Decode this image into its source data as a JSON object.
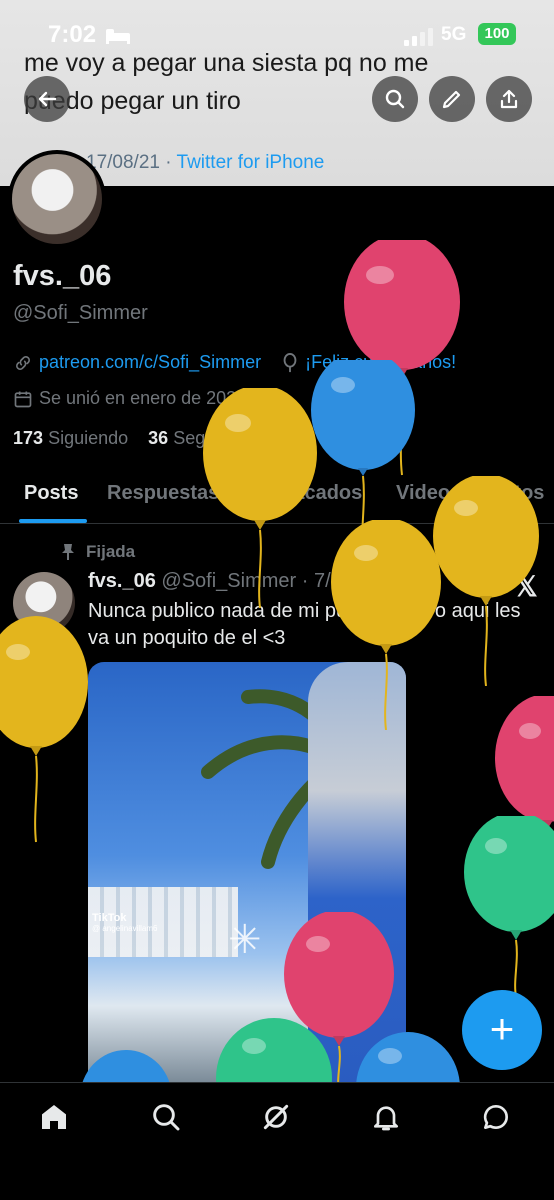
{
  "status_bar": {
    "time": "7:02",
    "network": "5G",
    "battery": "100"
  },
  "background_tweet": {
    "text": "me voy a pegar una siesta pq no me puedo pegar un tiro",
    "date": "17/08/21",
    "separator": "·",
    "source": "Twitter for iPhone"
  },
  "profile": {
    "name": "fvs._06",
    "handle": "@Sofi_Simmer",
    "link": "patreon.com/c/Sofi_Simmer",
    "birthday": "¡Feliz cumpleaños!",
    "joined": "Se unió en enero de 2023",
    "following_count": "173",
    "following_label": "Siguiendo",
    "followers_count": "36",
    "followers_label": "Seguidores"
  },
  "tabs": [
    "Posts",
    "Respuestas",
    "Destacados",
    "Videos",
    "Fotos"
  ],
  "pinned_tweet": {
    "pinned_label": "Fijada",
    "name": "fvs._06",
    "handle": "@Sofi_Simmer",
    "separator": "·",
    "date": "7/5/26",
    "text": "Nunca publico nada de mi pueblito, pero aqui les va un poquito de el <3",
    "media_watermark": "TikTok",
    "media_user": "@ angelinavillam6"
  },
  "fab_label": "+",
  "colors": {
    "accent": "#1d9bf0",
    "balloon_red": "#e0436e",
    "balloon_yellow": "#e3b51d",
    "balloon_blue": "#2f8fe0",
    "balloon_green": "#2fc48a"
  },
  "icons": [
    "back-arrow-icon",
    "search-icon",
    "edit-icon",
    "share-icon",
    "link-icon",
    "balloon-icon",
    "calendar-icon",
    "pin-icon",
    "x-logo-icon",
    "home-icon",
    "explore-icon",
    "grok-icon",
    "bell-icon",
    "chat-icon"
  ]
}
